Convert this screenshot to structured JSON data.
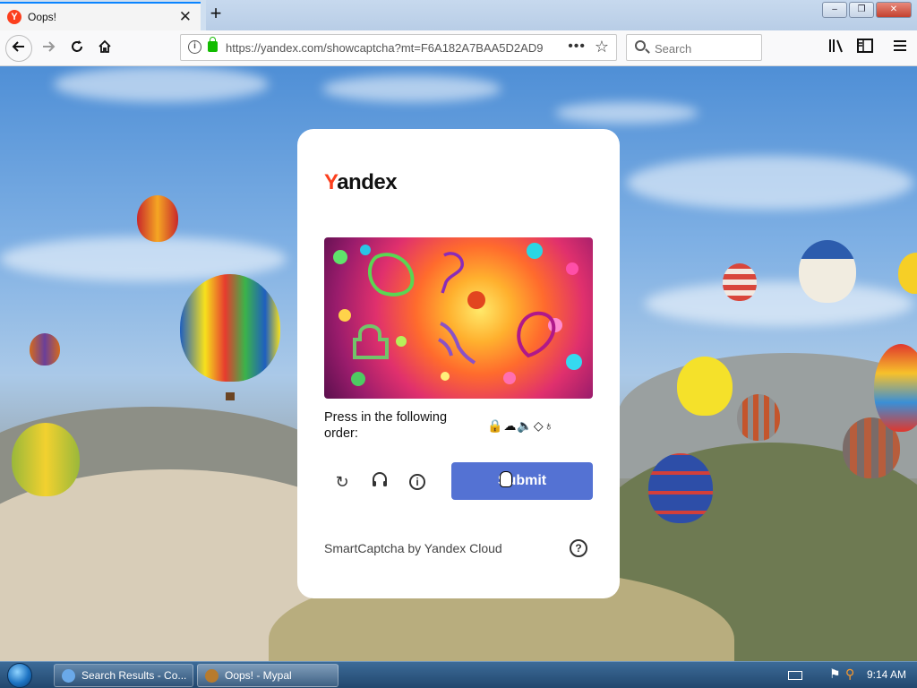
{
  "browser": {
    "tab": {
      "favicon": "Y",
      "title": "Oops!",
      "close_label": "✕"
    },
    "new_tab_label": "+",
    "window_controls": {
      "minimize": "–",
      "restore": "❐",
      "close": "✕"
    },
    "url": "https://yandex.com/showcaptcha?mt=F6A182A7BAA5D2AD9",
    "search": {
      "placeholder": "Search"
    },
    "icons": [
      "back-arrow-icon",
      "forward-arrow-icon",
      "reload-icon",
      "home-icon",
      "info-icon",
      "lock-icon",
      "page-actions-icon",
      "bookmark-star-icon",
      "search-icon",
      "library-icon",
      "sidebar-icon",
      "menu-icon"
    ]
  },
  "captcha": {
    "logo_first": "Y",
    "logo_rest": "andex",
    "prompt": "Press in the following order:",
    "sequence_icons": [
      "lock-icon",
      "cloud-icon",
      "speaker-icon",
      "tag-icon",
      "balloon-icon"
    ],
    "sequence_glyphs": "🔒☁🔈◇♁",
    "controls": {
      "refresh": "↻",
      "audio": "🎧",
      "info": "i"
    },
    "submit_label": "Submit",
    "footer_text": "SmartCaptcha by Yandex Cloud",
    "help_label": "?"
  },
  "taskbar": {
    "tasks": [
      {
        "label": "Search Results - Co..."
      },
      {
        "label": "Oops! - Mypal"
      }
    ],
    "clock": "9:14 AM"
  },
  "colors": {
    "accent_blue": "#5472d3",
    "yandex_red": "#fc3f1d",
    "secure_green": "#12bc00"
  }
}
